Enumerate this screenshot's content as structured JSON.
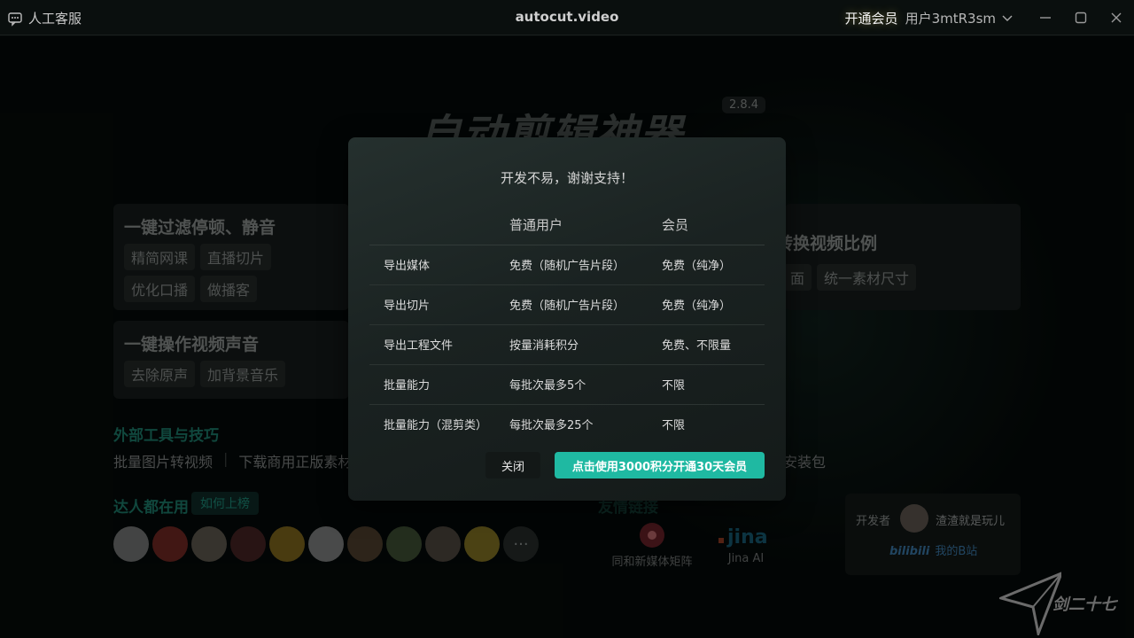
{
  "titlebar": {
    "support_label": "人工客服",
    "brand": "autocut.video",
    "vip_label": "开通会员",
    "user_name": "用户3mtR3sm"
  },
  "hero": {
    "title": "自动剪辑神器",
    "version": "2.8.4"
  },
  "features": {
    "card1": {
      "title": "一键过滤停顿、静音",
      "chips": [
        "精简网课",
        "直播切片",
        "优化口播",
        "做播客"
      ]
    },
    "card2": {
      "title": "一键操作视频声音",
      "chips": [
        "去除原声",
        "加背景音乐"
      ]
    },
    "card3": {
      "title": "转换视频比例",
      "chips": [
        "面",
        "统一素材尺寸"
      ]
    }
  },
  "tools": {
    "title": "外部工具与技巧",
    "items": [
      "批量图片转视频",
      "下载商用正版素材"
    ],
    "right_item": "安装包"
  },
  "experts": {
    "title": "达人都在用",
    "rank_button": "如何上榜",
    "more": "···"
  },
  "friends": {
    "title": "友情链接",
    "links": [
      "同和新媒体矩阵",
      "Jina AI"
    ]
  },
  "developer": {
    "label": "开发者",
    "name": "渣渣就是玩儿",
    "bili_logo": "bilibili",
    "bili_link": "我的B站"
  },
  "watermark": "剑二十七",
  "modal": {
    "title": "开发不易，谢谢支持！",
    "headers": [
      "",
      "普通用户",
      "会员"
    ],
    "rows": [
      [
        "导出媒体",
        "免费（随机广告片段）",
        "免费（纯净）"
      ],
      [
        "导出切片",
        "免费（随机广告片段）",
        "免费（纯净）"
      ],
      [
        "导出工程文件",
        "按量消耗积分",
        "免费、不限量"
      ],
      [
        "批量能力",
        "每批次最多5个",
        "不限"
      ],
      [
        "批量能力（混剪类）",
        "每批次最多25个",
        "不限"
      ]
    ],
    "close_label": "关闭",
    "vip_label": "点击使用3000积分开通30天会员"
  },
  "colors": {
    "accent": "#1fb9a2",
    "section_title": "#1d7a6a",
    "background": "#050a09"
  },
  "icons": [
    "chat-icon",
    "chevron-down-icon",
    "minimize-icon",
    "maximize-icon",
    "close-icon"
  ]
}
